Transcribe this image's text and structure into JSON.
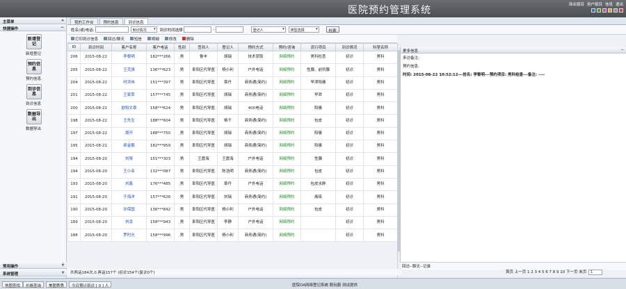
{
  "header": {
    "title": "医院预约管理系统",
    "links": [
      "商业版目",
      "用户版目",
      "信息",
      "退出"
    ]
  },
  "sidebar": {
    "menu_title": "主菜单",
    "section_title": "快捷操作",
    "buttons": [
      {
        "text": "新增登记",
        "label": "新增登记"
      },
      {
        "text": "预约信息",
        "label": "预约信息"
      },
      {
        "text": "到诊信息",
        "label": "到诊信息"
      },
      {
        "text": "数据导出",
        "label": "数据导出"
      }
    ],
    "bottom": [
      "常用操作",
      "系统管理"
    ]
  },
  "tabs": [
    "我的工作台",
    "预约信息",
    "到诊信息"
  ],
  "search": {
    "fields": [
      "姓名(或)电话:",
      "到诊情况",
      "到诊时间选择"
    ],
    "selects": [
      "登记人",
      "类型选择"
    ],
    "button": "检索"
  },
  "toolbar": [
    "打印到诊信息",
    "回访/聊天",
    "短信",
    "明细",
    "修改",
    "删除"
  ],
  "table": {
    "headers": [
      "ID",
      "到诊时间",
      "客户名称",
      "客户电话",
      "性别",
      "签到人",
      "登记人",
      "预约方式",
      "预约/咨询",
      "流行项目",
      "到诊情况",
      "科室名称"
    ],
    "rows": [
      [
        "206",
        "2015-08-22",
        "李黎明",
        "182***266",
        "男",
        "鲁丰",
        "胡瑞",
        "技术获取",
        "网络预约",
        "男科检查",
        "初诊",
        "男科"
      ],
      [
        "205",
        "2015-08-22",
        "王克强",
        "136***623",
        "男",
        "阜阳区代导医",
        "杨小利",
        "户外电话",
        "网络预约",
        "性腺、前列腺",
        "初诊",
        "男科"
      ],
      [
        "204",
        "2015-08-22",
        "时洪伟",
        "151***397",
        "男",
        "阜阳区代导医",
        "章丹",
        "商务通(简约)",
        "网络预约",
        "早泄阳痿",
        "初诊",
        "男科"
      ],
      [
        "201",
        "2015-08-22",
        "王家荣",
        "157***745",
        "男",
        "阜阳区代导医",
        "胡瑞",
        "商务通(简约)",
        "网络预约",
        "早泄",
        "初诊",
        "男科"
      ],
      [
        "200",
        "2015-08-22",
        "欧阳文章",
        "158***624",
        "男",
        "阜阳区代导医",
        "胡瑞",
        "400电话",
        "网络预约",
        "阳痿",
        "初诊",
        "男科"
      ],
      [
        "198",
        "2015-08-22",
        "王先生",
        "188***604",
        "男",
        "阜阳区代导医",
        "杨千",
        "商务通(简约)",
        "网络预约",
        "包皮",
        "初诊",
        "男科"
      ],
      [
        "197",
        "2015-08-22",
        "周开",
        "188***750",
        "男",
        "阜阳区代导医",
        "胡瑞",
        "商务通(简约)",
        "网络预约",
        "阳痿",
        "初诊",
        "男科"
      ],
      [
        "195",
        "2015-08-21",
        "郝金鹏",
        "182***959",
        "男",
        "阜阳区代导医",
        "胡瑞",
        "商务通(简约)",
        "网络预约",
        "阳痿",
        "初诊",
        "男科"
      ],
      [
        "194",
        "2015-08-20",
        "刘琴",
        "151***303",
        "男",
        "王震海",
        "王震海",
        "户外电话",
        "网络预约",
        "性腺",
        "初诊",
        "男科"
      ],
      [
        "194",
        "2015-08-20",
        "王小亚",
        "132***087",
        "男",
        "阜阳区代导医",
        "陈浩明",
        "商务通(简约)",
        "网络预约",
        "包皮",
        "初诊",
        "男科"
      ],
      [
        "193",
        "2015-08-20",
        "刘鑫",
        "176***485",
        "男",
        "阜阳区代导医",
        "章丹",
        "户外电话",
        "网络预约",
        "包皮水肿",
        "初诊",
        "男科"
      ],
      [
        "191",
        "2015-08-20",
        "于海洋",
        "157***626",
        "男",
        "阜阳区代导医",
        "刘瑞",
        "商务通(简约)",
        "网络预约",
        "痛痒",
        "初诊",
        "男科"
      ],
      [
        "190",
        "2015-08-20",
        "许保国",
        "136***842",
        "男",
        "阜阳区代导医",
        "杨小利",
        "户外电话",
        "网络预约",
        "包皮",
        "初诊",
        "男科"
      ],
      [
        "189",
        "2015-08-20",
        "刘凌",
        "158***943",
        "男",
        "阜阳区代导医",
        "李静",
        "户外电话",
        "网络预约",
        "",
        "初诊",
        "男科"
      ],
      [
        "188",
        "2015-08-20",
        "罗时光",
        "158***996",
        "男",
        "阜阳区代导医",
        "杨小利",
        "商务通(简约)",
        "网络预约",
        "",
        "初诊",
        "男科"
      ]
    ]
  },
  "table_footer": "共两话184次,0.再话157个 (初诊154个(复诊0个)",
  "right_panel": {
    "title": "更多信息",
    "lines": [
      "来访备注:",
      "预约信息:",
      "时间: 2015-08-22 10:52:12---姓名: 李黎明---预约项目: 男科检查---备注: ----"
    ],
    "footer": "回访--聊天--记录"
  },
  "pager": {
    "text": "首页  上一页  1 2 3 4 5 6 7 8 9 10  下一页  末页",
    "page": "1"
  },
  "status": {
    "buttons": [
      "地图查找",
      "价格查询",
      "美图秀秀",
      "今日预计到诊 [ 0 ] 人"
    ],
    "center": "医院OA网络登记系统 联玩服 测试提供"
  },
  "colors": {
    "accent": "#1a52b3",
    "green": "#1d8a1d"
  }
}
